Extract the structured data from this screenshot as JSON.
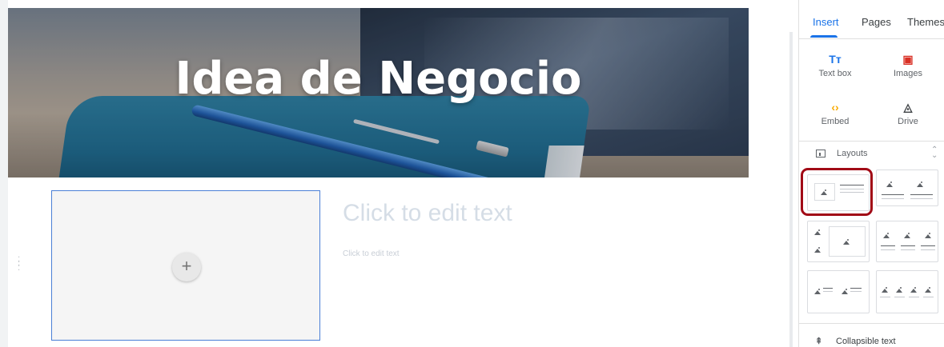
{
  "page": {
    "hero_title": "Idea de Negocio",
    "edit_heading": "Click to edit text",
    "edit_body": "Click to edit text",
    "add_symbol": "+"
  },
  "panel": {
    "tabs": [
      {
        "label": "Insert",
        "active": true
      },
      {
        "label": "Pages",
        "active": false
      },
      {
        "label": "Themes",
        "active": false
      }
    ],
    "tools": [
      {
        "label": "Text box",
        "icon": "text-box-icon",
        "glyph": "Tт",
        "color": "#1a73e8"
      },
      {
        "label": "Images",
        "icon": "image-icon",
        "glyph": "▣",
        "color": "#d93025"
      },
      {
        "label": "Embed",
        "icon": "embed-icon",
        "glyph": "‹›",
        "color": "#f9ab00"
      },
      {
        "label": "Drive",
        "icon": "drive-icon",
        "glyph": "◬",
        "color": "#3c4043"
      }
    ],
    "layouts_label": "Layouts",
    "collapsible_label": "Collapsible text"
  },
  "colors": {
    "accent": "#1a73e8",
    "selection_border": "#4a7fd6",
    "highlight": "#a10a16"
  }
}
